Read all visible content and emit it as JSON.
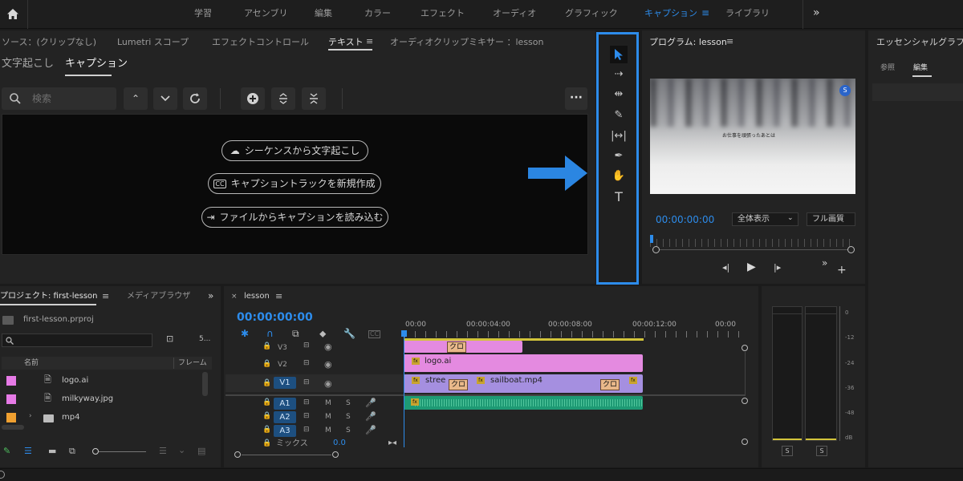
{
  "topbar": {
    "home_icon": "home-icon",
    "tabs": [
      "学習",
      "アセンブリ",
      "編集",
      "カラー",
      "エフェクト",
      "オーディオ",
      "グラフィック",
      "キャプション",
      "ライブラリ"
    ],
    "active_tab": "キャプション",
    "more_icon": "double-chevron-right-icon"
  },
  "source_panel": {
    "tabs": [
      "ソース：(クリップなし)",
      "Lumetri スコープ",
      "エフェクトコントロール",
      "テキスト",
      "オーディオクリップミキサー ：lesson"
    ],
    "active_tab": "テキスト",
    "subtabs": [
      "文字起こし",
      "キャプション"
    ],
    "active_subtab": "キャプション",
    "search_placeholder": "検索",
    "buttons": [
      {
        "icon": "cloud-upload-icon",
        "label": "シーケンスから文字起こし"
      },
      {
        "icon": "cc-icon",
        "label": "キャプショントラックを新規作成"
      },
      {
        "icon": "import-icon",
        "label": "ファイルからキャプションを読み込む"
      }
    ]
  },
  "program_monitor": {
    "title": "プログラム: lesson",
    "timecode": "00:00:00:00",
    "zoom": "全体表示",
    "quality": "フル画質",
    "subtitle_text": "お仕事を頑張ったあとは"
  },
  "essential_panel": {
    "title": "エッセンシャルグラフィ",
    "tabs": [
      "参照",
      "編集"
    ],
    "active_tab": "編集"
  },
  "project_panel": {
    "tabs": [
      "プロジェクト: first-lesson",
      "メディアブラウザ"
    ],
    "file_name": "first-lesson.prproj",
    "count": "5...",
    "columns": [
      "名前",
      "フレーム"
    ],
    "items": [
      {
        "name": "logo.ai",
        "color": "#e67ae6"
      },
      {
        "name": "milkyway.jpg",
        "color": "#e67ae6"
      },
      {
        "name": "mp4",
        "color": "#f0a030"
      }
    ]
  },
  "timeline": {
    "sequence": "lesson",
    "timecode": "00:00:00:00",
    "ruler": [
      "00:00",
      "00:00:04:00",
      "00:00:08:00",
      "00:00:12:00",
      "00:00"
    ],
    "video_tracks": [
      "V3",
      "V2",
      "V1"
    ],
    "audio_tracks": [
      "A1",
      "A2",
      "A3"
    ],
    "mix_label": "ミックス",
    "mix_value": "0.0",
    "clips": {
      "v2": "logo.ai",
      "v1a": "stree",
      "v1b": "sailboat.mp4",
      "cross": "クロ"
    },
    "ms": [
      "M",
      "S"
    ]
  },
  "meter": {
    "scale": [
      "0",
      "-12",
      "-24",
      "-36",
      "-48",
      "dB"
    ],
    "solo": [
      "S",
      "S"
    ]
  },
  "colors": {
    "accent": "#2d8ceb",
    "highlight_box": "#2d8ceb",
    "clip_pink": "#e48ae0",
    "clip_purple": "#a58fe0",
    "audio_green": "#1e9a74"
  }
}
